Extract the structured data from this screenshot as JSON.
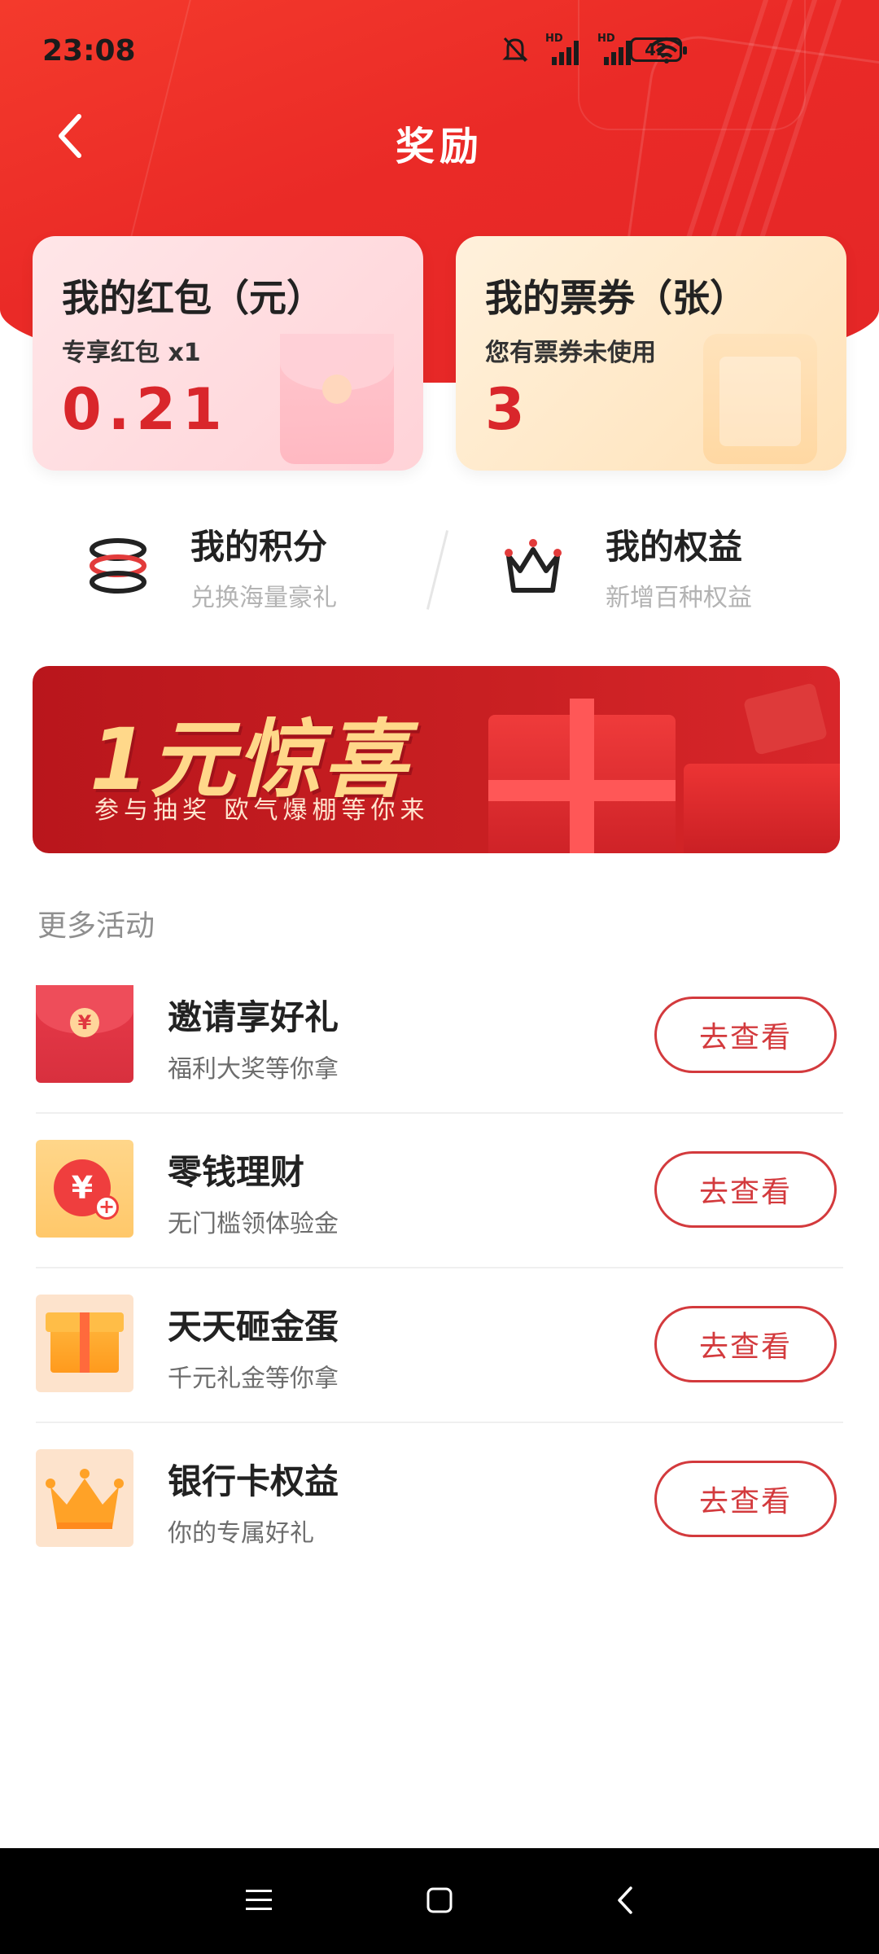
{
  "status_bar": {
    "time": "23:08",
    "battery": "42"
  },
  "header": {
    "title": "奖励"
  },
  "cards": {
    "red_packet": {
      "title": "我的红包（元）",
      "subtitle": "专享红包 x1",
      "value": "0.21"
    },
    "tickets": {
      "title": "我的票券（张）",
      "subtitle": "您有票券未使用",
      "value": "3"
    }
  },
  "shortcuts": [
    {
      "title": "我的积分",
      "desc": "兑换海量豪礼"
    },
    {
      "title": "我的权益",
      "desc": "新增百种权益"
    }
  ],
  "banner": {
    "headline": "1元惊喜",
    "tagline": "参与抽奖  欧气爆棚等你来"
  },
  "more": {
    "section_title": "更多活动",
    "items": [
      {
        "title": "邀请享好礼",
        "desc": "福利大奖等你拿",
        "button": "去查看",
        "icon": "red-packet-icon"
      },
      {
        "title": "零钱理财",
        "desc": "无门槛领体验金",
        "button": "去查看",
        "icon": "yuan-coin-icon"
      },
      {
        "title": "天天砸金蛋",
        "desc": "千元礼金等你拿",
        "button": "去查看",
        "icon": "gift-box-icon"
      },
      {
        "title": "银行卡权益",
        "desc": "你的专属好礼",
        "button": "去查看",
        "icon": "crown-icon"
      }
    ]
  },
  "colors": {
    "accent": "#e42627",
    "value_red": "#d9262b",
    "banner_text": "#ffd88a"
  }
}
